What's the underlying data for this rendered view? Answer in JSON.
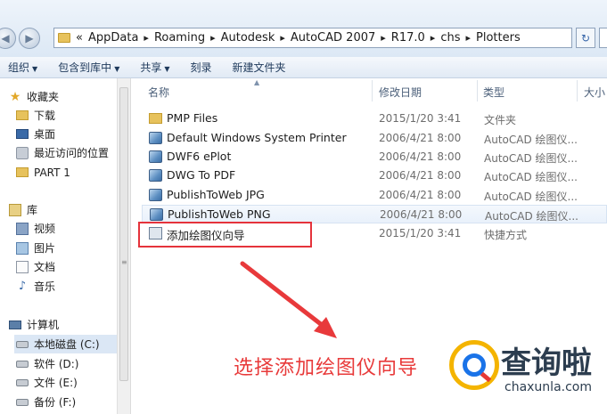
{
  "address": {
    "prefix": "«",
    "crumbs": [
      "AppData",
      "Roaming",
      "Autodesk",
      "AutoCAD 2007",
      "R17.0",
      "chs",
      "Plotters"
    ]
  },
  "toolbar": {
    "organize": "组织",
    "include_library": "包含到库中",
    "share": "共享",
    "burn": "刻录",
    "new_folder": "新建文件夹"
  },
  "sidebar": {
    "favorites": "收藏夹",
    "downloads": "下载",
    "desktop": "桌面",
    "recent": "最近访问的位置",
    "part1": "PART 1",
    "libraries": "库",
    "videos": "视频",
    "pictures": "图片",
    "documents": "文档",
    "music": "音乐",
    "computer": "计算机",
    "drive_c": "本地磁盘 (C:)",
    "drive_d": "软件 (D:)",
    "drive_e": "文件 (E:)",
    "drive_f": "备份 (F:)"
  },
  "columns": {
    "name": "名称",
    "modified": "修改日期",
    "type": "类型",
    "size": "大小"
  },
  "files": [
    {
      "name": "PMP Files",
      "date": "2015/1/20 3:41",
      "type": "文件夹",
      "icon": "folder-icon"
    },
    {
      "name": "Default Windows System Printer",
      "date": "2006/4/21 8:00",
      "type": "AutoCAD 绘图仪...",
      "icon": "plotter-icon"
    },
    {
      "name": "DWF6 ePlot",
      "date": "2006/4/21 8:00",
      "type": "AutoCAD 绘图仪...",
      "icon": "plotter-icon"
    },
    {
      "name": "DWG To PDF",
      "date": "2006/4/21 8:00",
      "type": "AutoCAD 绘图仪...",
      "icon": "plotter-icon"
    },
    {
      "name": "PublishToWeb JPG",
      "date": "2006/4/21 8:00",
      "type": "AutoCAD 绘图仪...",
      "icon": "plotter-icon"
    },
    {
      "name": "PublishToWeb PNG",
      "date": "2006/4/21 8:00",
      "type": "AutoCAD 绘图仪...",
      "icon": "plotter-icon"
    },
    {
      "name": "添加绘图仪向导",
      "date": "2015/1/20 3:41",
      "type": "快捷方式",
      "icon": "shortcut-icon"
    }
  ],
  "annotation": "选择添加绘图仪向导",
  "watermark": {
    "brand": "查询啦",
    "url": "chaxunla.com"
  },
  "colors": {
    "highlight_box": "#e5333b",
    "annotation_text": "#e83a3a"
  }
}
